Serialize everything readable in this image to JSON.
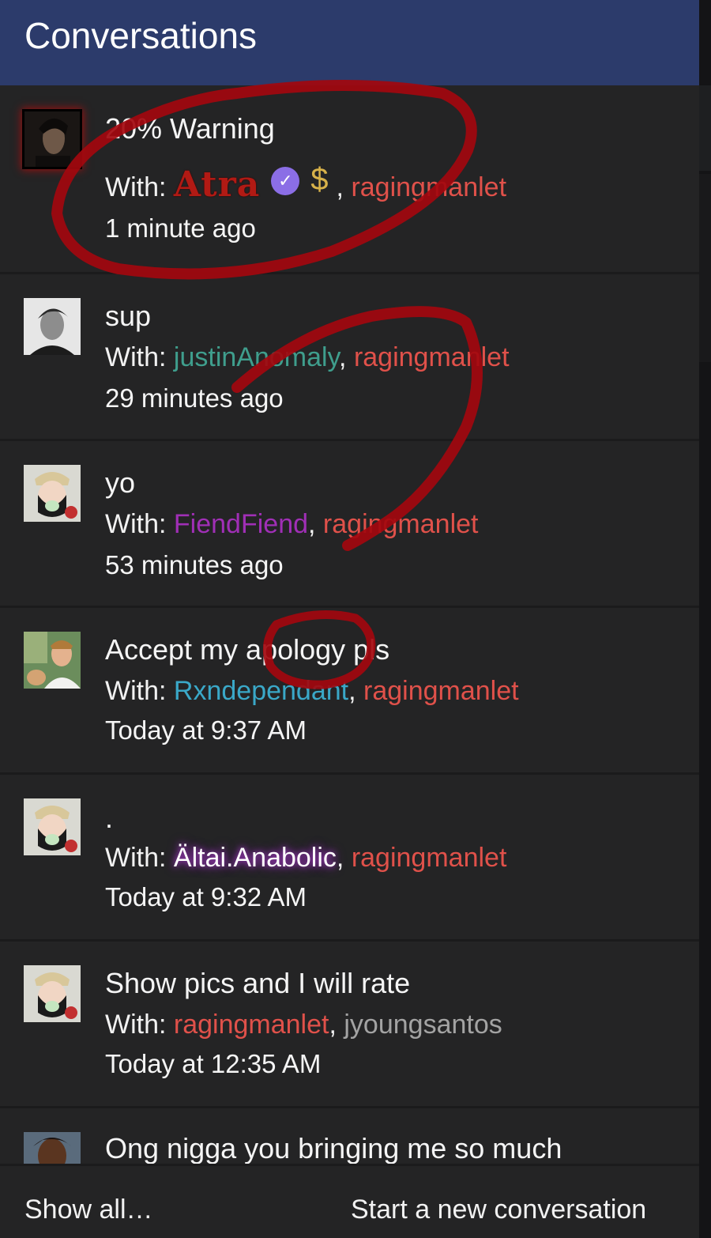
{
  "header": {
    "title": "Conversations"
  },
  "with_label": "With:",
  "conversations": [
    {
      "title": "20% Warning",
      "participants": [
        {
          "name": "Atra",
          "color": "#b11a14"
        },
        {
          "name": "ragingmanlet",
          "color": "#e0514a"
        }
      ],
      "badges": [
        "verified-check-icon",
        "dollar-icon"
      ],
      "time": "1 minute ago"
    },
    {
      "title": "sup",
      "participants": [
        {
          "name": "justinAnomaly",
          "color": "#3f9e8d"
        },
        {
          "name": "ragingmanlet",
          "color": "#e0514a"
        }
      ],
      "time": "29 minutes ago"
    },
    {
      "title": "yo",
      "participants": [
        {
          "name": "FiendFiend",
          "color": "#a02fb6"
        },
        {
          "name": "ragingmanlet",
          "color": "#e0514a"
        }
      ],
      "time": "53 minutes ago"
    },
    {
      "title": "Accept my apology pls",
      "participants": [
        {
          "name": "Rxndependant",
          "color": "#3aa8c8"
        },
        {
          "name": "ragingmanlet",
          "color": "#e0514a"
        }
      ],
      "time": "Today at 9:37 AM"
    },
    {
      "title": ".",
      "participants": [
        {
          "name": "Ältai.Anabolic",
          "color": "#ffffff"
        },
        {
          "name": "ragingmanlet",
          "color": "#e0514a"
        }
      ],
      "time": "Today at 9:32 AM"
    },
    {
      "title": "Show pics and I will rate",
      "participants": [
        {
          "name": "ragingmanlet",
          "color": "#e0514a"
        },
        {
          "name": "jyoungsantos",
          "color": "#a3a3a3"
        }
      ],
      "time": "Today at 12:35 AM"
    },
    {
      "title": "Ong nigga you bringing me so much"
    }
  ],
  "footer": {
    "show_all": "Show all…",
    "new_conversation": "Start a new conversation"
  },
  "colors": {
    "header_bg": "#2c3b6b",
    "list_bg": "#242425",
    "scribble": "#a3080e"
  }
}
